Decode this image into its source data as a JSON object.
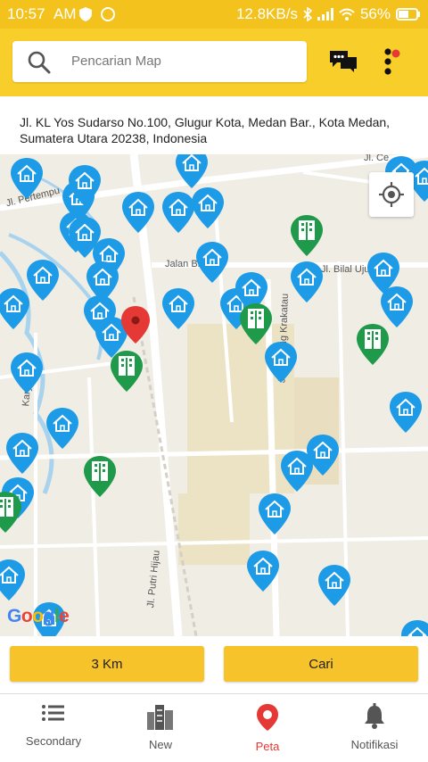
{
  "status": {
    "time": "10:57",
    "ampm": "AM",
    "speed": "12.8KB/s",
    "battery": "56%"
  },
  "search": {
    "placeholder": "Pencarian Map"
  },
  "address": "Jl. KL Yos Sudarso No.100, Glugur Kota, Medan Bar., Kota Medan, Sumatera Utara 20238, Indonesia",
  "map": {
    "streets": [
      "Jl. Pertempu",
      "Jalan Bilal",
      "Jl. Bilal Ujung",
      "Jl. Gunung Krakatau",
      "Jl. Putri Hijau",
      "Karya",
      "Jl. Ce"
    ],
    "logo": "Google"
  },
  "buttons": {
    "radius": "3 Km",
    "search": "Cari"
  },
  "nav": [
    {
      "label": "Secondary",
      "icon": "list-icon"
    },
    {
      "label": "New",
      "icon": "buildings-icon"
    },
    {
      "label": "Peta",
      "icon": "map-pin-icon"
    },
    {
      "label": "Notifikasi",
      "icon": "bell-icon"
    }
  ],
  "colors": {
    "accent": "#f8cf2a",
    "pin_blue": "#1e9be6",
    "pin_green": "#1f9a4a",
    "active": "#e53935"
  }
}
